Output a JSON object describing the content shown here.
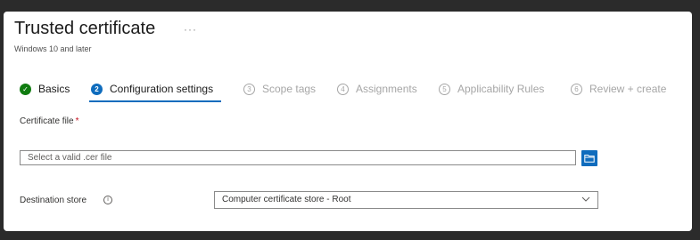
{
  "page": {
    "title": "Trusted certificate",
    "more_glyph": "···",
    "subtitle": "Windows 10 and later"
  },
  "steps": [
    {
      "number": "✓",
      "label": "Basics",
      "state": "done"
    },
    {
      "number": "2",
      "label": "Configuration settings",
      "state": "active"
    },
    {
      "number": "3",
      "label": "Scope tags",
      "state": "pending"
    },
    {
      "number": "4",
      "label": "Assignments",
      "state": "pending"
    },
    {
      "number": "5",
      "label": "Applicability Rules",
      "state": "pending"
    },
    {
      "number": "6",
      "label": "Review + create",
      "state": "pending"
    }
  ],
  "form": {
    "certificate_file": {
      "label": "Certificate file",
      "required_mark": "*",
      "placeholder": "Select a valid .cer file",
      "browse_icon": "folder-icon"
    },
    "destination_store": {
      "label": "Destination store",
      "info_glyph": "i",
      "value": "Computer certificate store - Root"
    }
  },
  "colors": {
    "accent": "#0f6cbd",
    "success": "#107c10",
    "required": "#c50f1f"
  }
}
